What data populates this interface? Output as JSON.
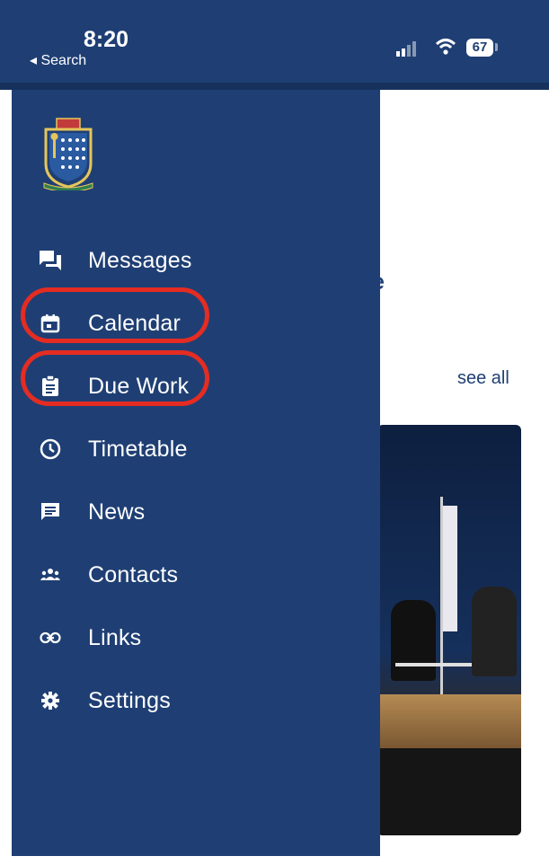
{
  "status": {
    "time": "8:20",
    "back_label": "Search",
    "battery": "67"
  },
  "main": {
    "heading_fragment": "e",
    "see_all": "see all"
  },
  "drawer": {
    "menu": [
      {
        "label": "Messages",
        "icon": "messages-icon"
      },
      {
        "label": "Calendar",
        "icon": "calendar-icon"
      },
      {
        "label": "Due Work",
        "icon": "clipboard-icon"
      },
      {
        "label": "Timetable",
        "icon": "clock-icon"
      },
      {
        "label": "News",
        "icon": "news-icon"
      },
      {
        "label": "Contacts",
        "icon": "contacts-icon"
      },
      {
        "label": "Links",
        "icon": "link-icon"
      },
      {
        "label": "Settings",
        "icon": "gear-icon"
      }
    ]
  },
  "colors": {
    "drawer": "#1f3f74",
    "highlight": "#e52c22"
  }
}
